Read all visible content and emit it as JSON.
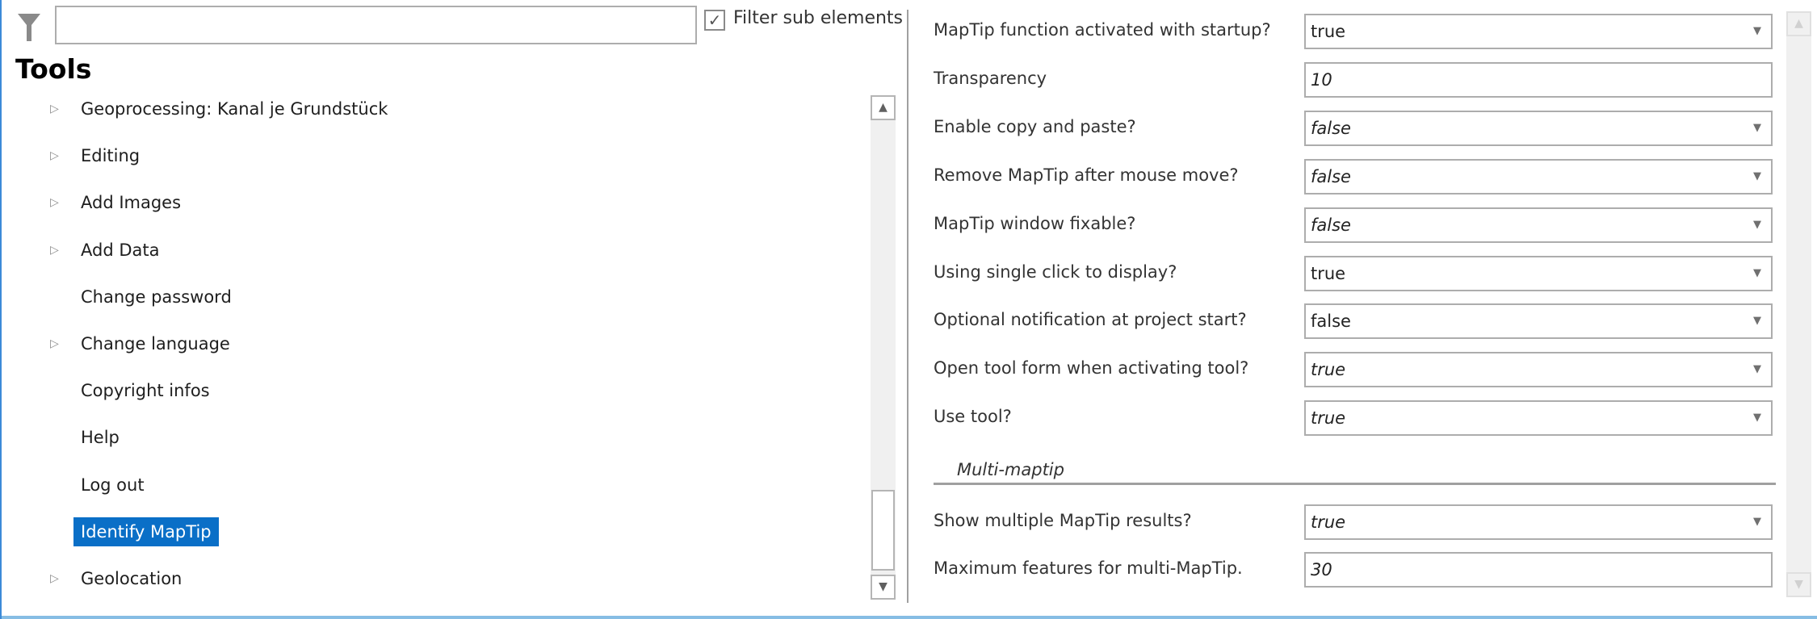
{
  "filter": {
    "search_value": "",
    "checkbox_checked": true,
    "checkbox_label": "Filter sub elements"
  },
  "tools": {
    "title": "Tools",
    "items": [
      {
        "label": "Geoprocessing: Kanal je Grundstück",
        "expandable": true
      },
      {
        "label": "Editing",
        "expandable": true
      },
      {
        "label": "Add Images",
        "expandable": true
      },
      {
        "label": "Add Data",
        "expandable": true
      },
      {
        "label": "Change password",
        "expandable": false
      },
      {
        "label": "Change language",
        "expandable": true
      },
      {
        "label": "Copyright infos",
        "expandable": false
      },
      {
        "label": "Help",
        "expandable": false
      },
      {
        "label": "Log out",
        "expandable": false
      },
      {
        "label": "Identify MapTip",
        "expandable": false,
        "selected": true
      },
      {
        "label": "Geolocation",
        "expandable": true
      }
    ]
  },
  "properties": [
    {
      "label": "MapTip function activated with startup?",
      "value": "true",
      "italic": false,
      "dropdown": true
    },
    {
      "label": "Transparency",
      "value": "10",
      "italic": true,
      "dropdown": false
    },
    {
      "label": "Enable copy and paste?",
      "value": "false",
      "italic": true,
      "dropdown": true
    },
    {
      "label": "Remove MapTip after mouse move?",
      "value": "false",
      "italic": true,
      "dropdown": true
    },
    {
      "label": "MapTip window fixable?",
      "value": "false",
      "italic": true,
      "dropdown": true
    },
    {
      "label": "Using single click to display?",
      "value": "true",
      "italic": false,
      "dropdown": true
    },
    {
      "label": "Optional notification at project start?",
      "value": "false",
      "italic": false,
      "dropdown": true
    },
    {
      "label": "Open tool form when activating tool?",
      "value": "true",
      "italic": true,
      "dropdown": true
    },
    {
      "label": "Use tool?",
      "value": "true",
      "italic": true,
      "dropdown": true
    }
  ],
  "group": {
    "title": "Multi-maptip",
    "properties": [
      {
        "label": "Show multiple MapTip results?",
        "value": "true",
        "italic": true,
        "dropdown": true
      },
      {
        "label": "Maximum features for multi-MapTip.",
        "value": "30",
        "italic": true,
        "dropdown": false
      }
    ]
  },
  "icons": {
    "filter": "funnel-icon",
    "check": "✓",
    "dropdown": "▼",
    "scroll_up": "▲",
    "scroll_down": "▼",
    "expand": "▷"
  },
  "colors": {
    "selection": "#0a6fc7",
    "accent_border": "#3c8ad8"
  }
}
